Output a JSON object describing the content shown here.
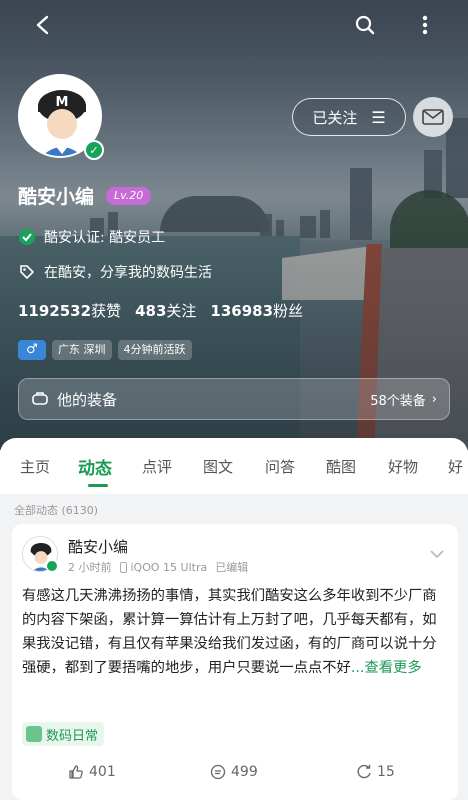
{
  "topbar": {
    "back_icon": "back-arrow-icon",
    "search_icon": "search-icon",
    "more_icon": "more-vertical-icon"
  },
  "profile": {
    "name": "酷安小编",
    "level": "Lv.20",
    "certification": "酷安认证: 酷安员工",
    "bio": "在酷安，分享我的数码生活",
    "follow_label": "已关注",
    "stats": {
      "likes": "1192532",
      "likes_label": "获赞",
      "following": "483",
      "following_label": "关注",
      "fans": "136983",
      "fans_label": "粉丝"
    },
    "gender": "♂",
    "location": "广东 深圳",
    "active": "4分钟前活跃",
    "gear_label": "他的装备",
    "gear_count": "58个装备"
  },
  "tabs": [
    "主页",
    "动态",
    "点评",
    "图文",
    "问答",
    "酷图",
    "好物",
    "好"
  ],
  "active_tab": "动态",
  "all_count": "全部动态 (6130)",
  "post": {
    "author": "酷安小编",
    "time": "2 小时前",
    "device": "iQOO 15 Ultra",
    "edited": "已编辑",
    "text": "有感这几天沸沸扬扬的事情，其实我们酷安这么多年收到不少厂商的内容下架函，累计算一算估计有上万封了吧，几乎每天都有，如果我没记错，有且仅有苹果没给我们发过函，有的厂商可以说十分强硬，都到了要捂嘴的地步，用户只要说一点点不好",
    "more": "...查看更多",
    "topic": "数码日常",
    "likes": "401",
    "comments": "499",
    "shares": "15"
  },
  "colors": {
    "accent": "#1a9a55",
    "level_badge": "#c86bd8",
    "gender": "#3a86d6"
  }
}
